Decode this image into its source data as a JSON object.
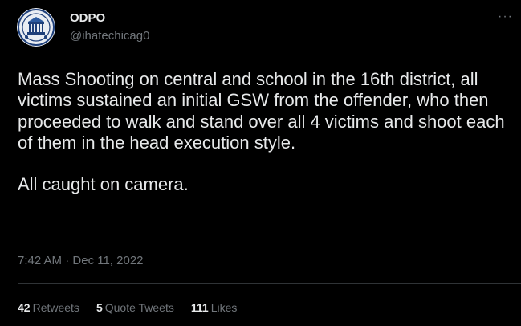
{
  "author": {
    "display_name": "ODPO",
    "handle": "@ihatechicag0",
    "avatar_icon": "police-badge-icon"
  },
  "menu": {
    "more_label": "···"
  },
  "tweet": {
    "text": "Mass Shooting on central and school in the 16th district, all victims sustained an initial GSW from the offender, who then proceeded to walk and stand over all 4 victims and shoot each of them in the head execution style.\n\nAll caught on camera.",
    "time": "7:42 AM",
    "separator": "·",
    "date": "Dec 11, 2022"
  },
  "stats": {
    "retweets_count": "42",
    "retweets_label": "Retweets",
    "quotes_count": "5",
    "quotes_label": "Quote Tweets",
    "likes_count": "111",
    "likes_label": "Likes"
  },
  "colors": {
    "background": "#000000",
    "text_primary": "#e7e9ea",
    "text_secondary": "#71767b",
    "divider": "#2f3336"
  }
}
